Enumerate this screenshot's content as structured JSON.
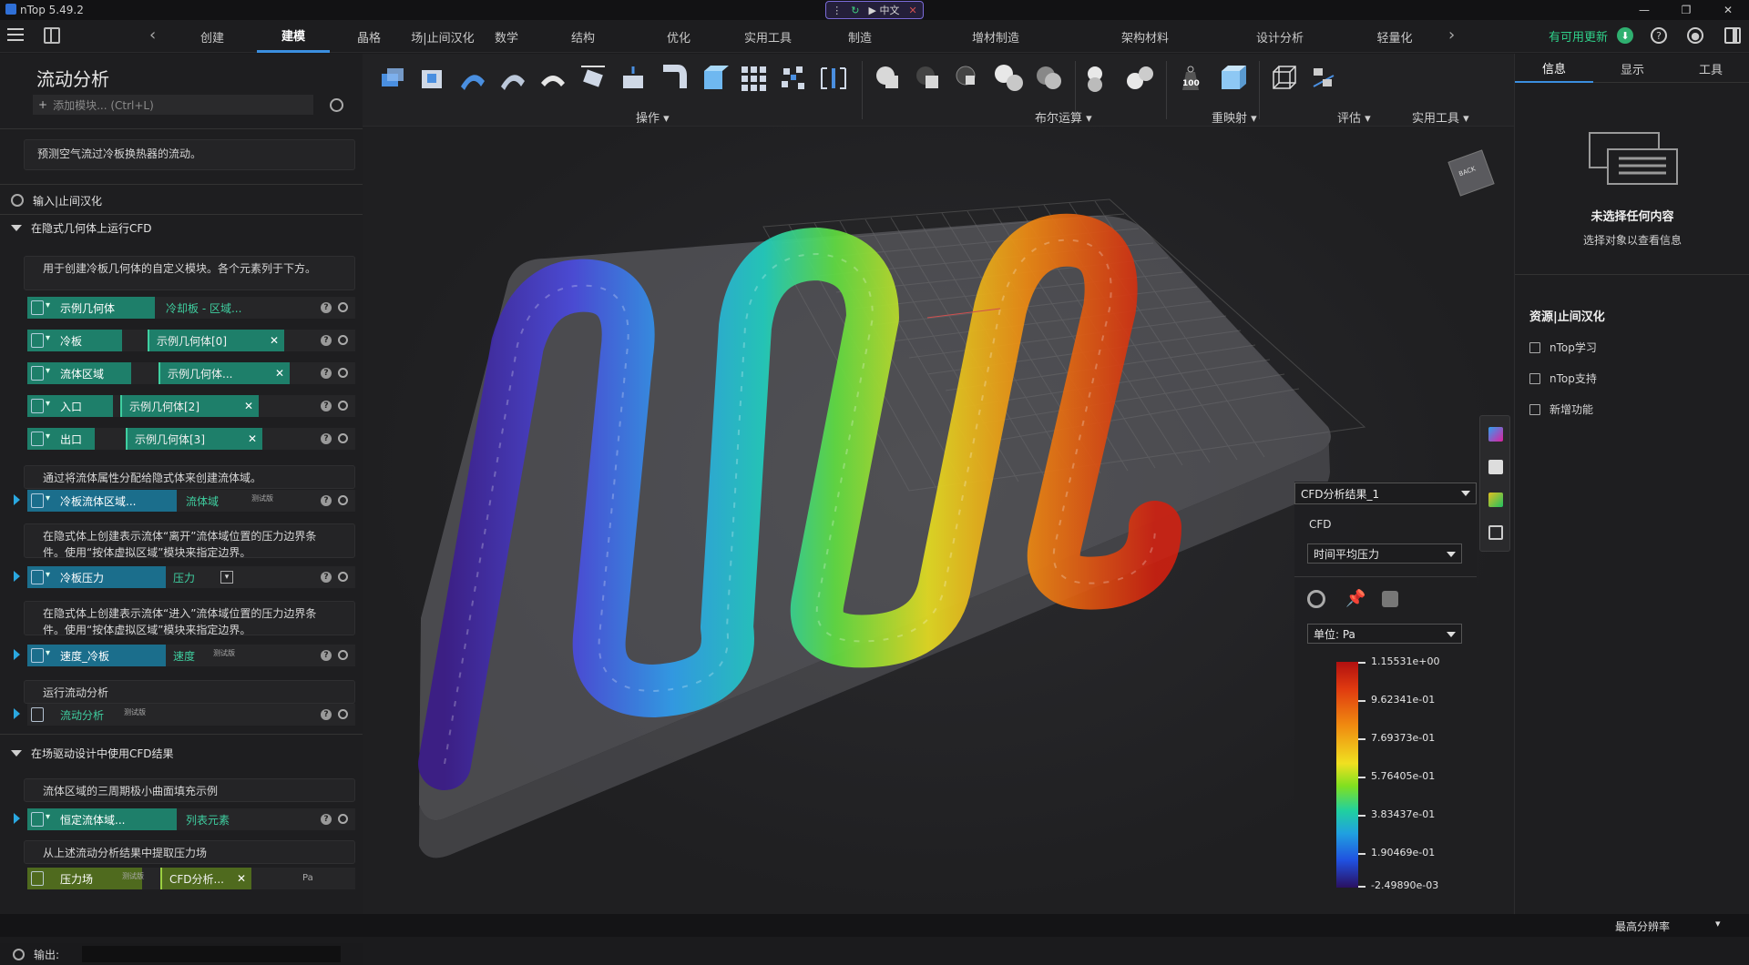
{
  "window": {
    "title": "nTop 5.49.2",
    "lang_label": "▶ 中文",
    "controls": [
      "—",
      "❐",
      "✕"
    ]
  },
  "menubar": {
    "tabs": [
      "创建",
      "建模",
      "晶格",
      "场|止间汉化",
      "数学",
      "结构",
      "优化",
      "实用工具",
      "制造",
      "增材制造",
      "架构材料",
      "设计分析",
      "轻量化"
    ],
    "active_tab": "建模",
    "update_text": "有可用更新"
  },
  "left_panel": {
    "title": "流动分析",
    "add_module_placeholder": "添加模块... (Ctrl+L)",
    "description": "预测空气流过冷板换热器的流动。",
    "inputs_section": "输入|止间汉化",
    "section1": "在隐式几何体上运行CFD",
    "group1_desc": "用于创建冷板几何体的自定义模块。各个元素列于下方。",
    "rows_group1": [
      {
        "label": "示例几何体",
        "value": "冷却板 - 区域..."
      },
      {
        "label": "冷板",
        "value": "示例几何体[0]"
      },
      {
        "label": "流体区域",
        "value": "示例几何体..."
      },
      {
        "label": "入口",
        "value": "示例几何体[2]"
      },
      {
        "label": "出口",
        "value": "示例几何体[3]"
      }
    ],
    "group2_desc": "通过将流体属性分配给隐式体来创建流体域。",
    "row2": {
      "label": "冷板流体区域...",
      "value": "流体域",
      "mini": "测试版"
    },
    "group3_desc": "在隐式体上创建表示流体“离开”流体域位置的压力边界条件。使用“按体虚拟区域”模块来指定边界。",
    "row3": {
      "label": "冷板压力",
      "value": "压力"
    },
    "group4_desc": "在隐式体上创建表示流体“进入”流体域位置的压力边界条件。使用“按体虚拟区域”模块来指定边界。",
    "row4": {
      "label": "速度_冷板",
      "value": "速度",
      "mini": "测试版"
    },
    "group5_desc": "运行流动分析",
    "row5": {
      "label": "流动分析",
      "mini": "测试版"
    },
    "section2": "在场驱动设计中使用CFD结果",
    "group6_desc": "流体区域的三周期极小曲面填充示例",
    "row6": {
      "label": "恒定流体域...",
      "value": "列表元素"
    },
    "group7_desc": "从上述流动分析结果中提取压力场",
    "row7": {
      "label": "压力场",
      "mini": "测试版",
      "value": "CFD分析...",
      "unit": "Pa"
    },
    "output_label": "输出:"
  },
  "toolbar": {
    "groups": [
      "操作",
      "布尔运算",
      "重映射",
      "评估",
      "实用工具"
    ],
    "weight_label": "100"
  },
  "viewport": {
    "navcube_text": "BACK",
    "result_select": "CFD分析结果_1",
    "cfd_label": "CFD",
    "field_select": "时间平均压力",
    "unit_select": "单位: Pa",
    "colorbar_ticks": [
      "1.15531e+00",
      "9.62341e-01",
      "7.69373e-01",
      "5.76405e-01",
      "3.83437e-01",
      "1.90469e-01",
      "-2.49890e-03"
    ]
  },
  "right_panel": {
    "tabs": [
      "信息",
      "显示",
      "工具"
    ],
    "active_tab": "信息",
    "no_selection": "未选择任何内容",
    "no_selection_hint": "选择对象以查看信息",
    "resources_title": "资源|止间汉化",
    "links": [
      "nTop学习",
      "nTop支持",
      "新增功能"
    ]
  },
  "statusbar": {
    "resolution": "最高分辨率"
  }
}
